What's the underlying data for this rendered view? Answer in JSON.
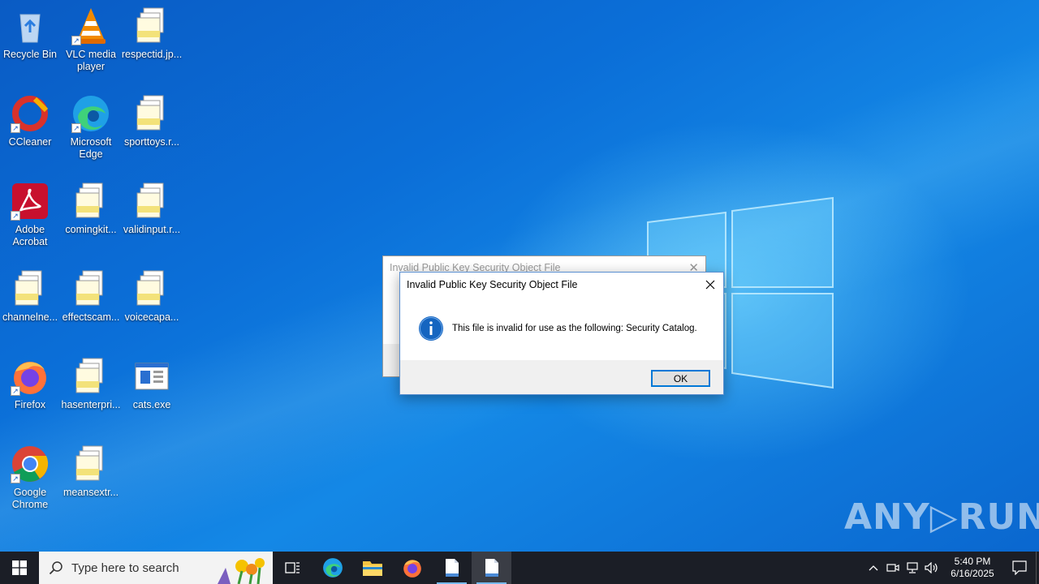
{
  "desktop": {
    "icons": [
      {
        "label": "Recycle Bin"
      },
      {
        "label": "VLC media player"
      },
      {
        "label": "respectid.jp..."
      },
      {
        "label": "CCleaner"
      },
      {
        "label": "Microsoft Edge"
      },
      {
        "label": "sporttoys.r..."
      },
      {
        "label": "Adobe Acrobat"
      },
      {
        "label": "comingkit..."
      },
      {
        "label": "validinput.r..."
      },
      {
        "label": "channelne..."
      },
      {
        "label": "effectscam..."
      },
      {
        "label": "voicecapa..."
      },
      {
        "label": "Firefox"
      },
      {
        "label": "hasenterpri..."
      },
      {
        "label": "cats.exe"
      },
      {
        "label": "Google Chrome"
      },
      {
        "label": "meansextr..."
      }
    ]
  },
  "dialog_back": {
    "title": "Invalid Public Key Security Object File"
  },
  "dialog": {
    "title": "Invalid Public Key Security Object File",
    "message": "This file is invalid for use as the following: Security Catalog.",
    "ok_label": "OK",
    "icon": "info-icon"
  },
  "watermark": "ANY▷RUN",
  "taskbar": {
    "search_placeholder": "Type here to search",
    "clock_time": "5:40 PM",
    "clock_date": "6/16/2025"
  },
  "colors": {
    "accent": "#0078d7",
    "taskbar": "#1b1e26",
    "info_blue": "#1565c0"
  }
}
